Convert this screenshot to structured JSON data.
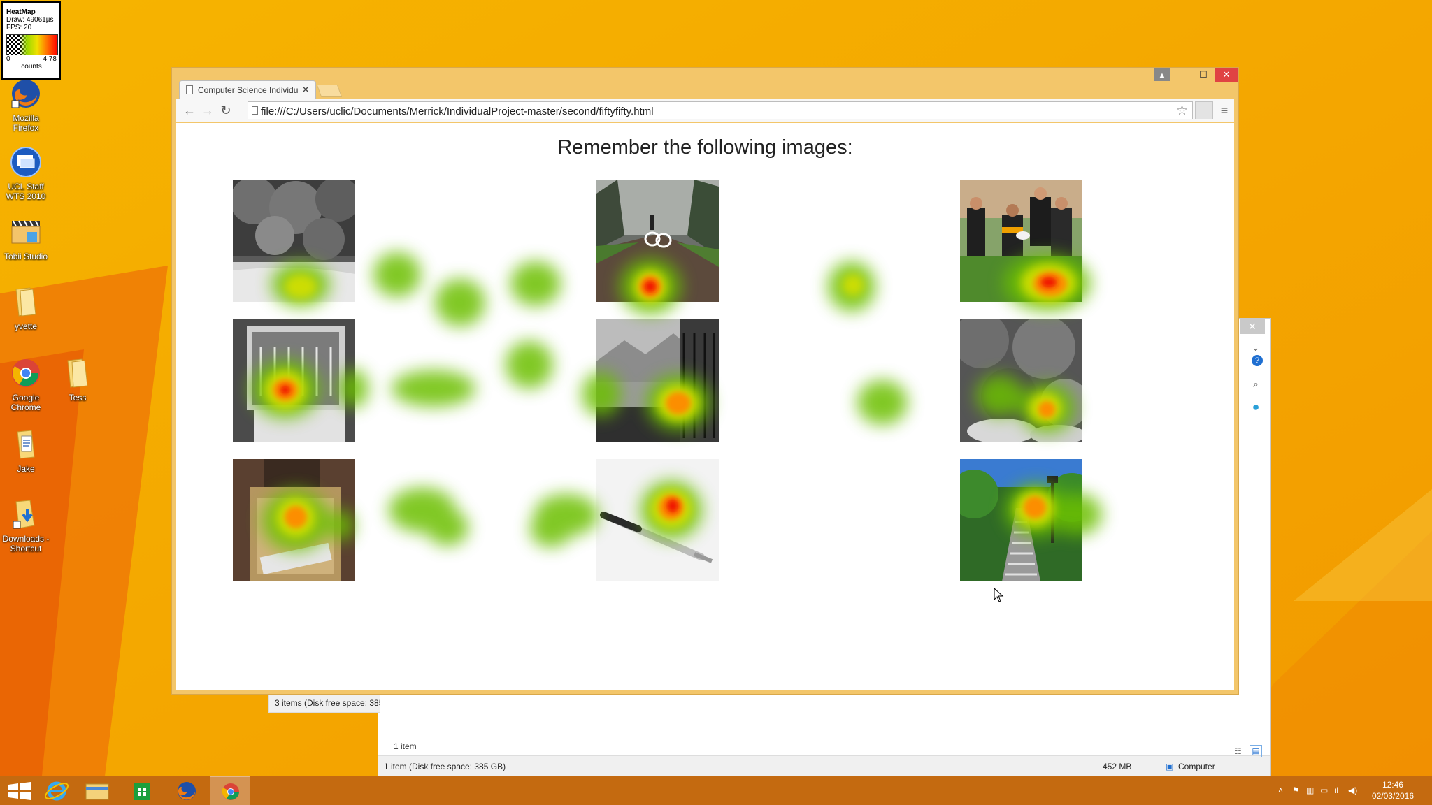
{
  "heatmap_widget": {
    "title": "HeatMap",
    "draw": "Draw: 49061µs",
    "fps": "FPS: 20",
    "min": "0",
    "max": "4.78",
    "unit": "counts"
  },
  "desktop": {
    "icons": [
      {
        "label": "Mozilla Firefox",
        "icon": "firefox-icon"
      },
      {
        "label": "UCL Staff WTS 2010",
        "icon": "remote-desktop-icon"
      },
      {
        "label": "Tobii Studio",
        "icon": "tobii-studio-icon"
      },
      {
        "label": "yvette",
        "icon": "folder-icon"
      },
      {
        "label": "Google Chrome",
        "icon": "chrome-icon"
      },
      {
        "label": "Tess",
        "icon": "folder-icon"
      },
      {
        "label": "Jake",
        "icon": "document-icon"
      },
      {
        "label": "Downloads - Shortcut",
        "icon": "folder-shortcut-icon"
      }
    ]
  },
  "browser": {
    "tab_title": "Computer Science Individu",
    "url": "file:///C:/Users/uclic/Documents/Merrick/IndividualProject-master/second/fiftyfifty.html",
    "page": {
      "heading": "Remember the following images:",
      "images": [
        {
          "subject": "black and white forest river"
        },
        {
          "subject": "headphones on a dirt path"
        },
        {
          "subject": "rugby players"
        },
        {
          "subject": "dishwasher with dishes"
        },
        {
          "subject": "black and white mountain lake balcony"
        },
        {
          "subject": "black and white foliage"
        },
        {
          "subject": "perfume bottle"
        },
        {
          "subject": "pen on white paper"
        },
        {
          "subject": "park stairs with lamps"
        }
      ]
    }
  },
  "explorer": {
    "item_count": "1 item",
    "status_left": "1 item (Disk free space: 385 GB)",
    "status_size": "452 MB",
    "status_location": "Computer",
    "back_status": "3 items (Disk free space: 385"
  },
  "taskbar": {
    "time": "12:46",
    "date": "02/03/2016",
    "apps": [
      "start-icon",
      "internet-explorer-icon",
      "file-explorer-icon",
      "store-icon",
      "firefox-icon",
      "chrome-icon"
    ]
  },
  "colors": {
    "wallpaper": "#f5a800",
    "taskbar": "#c46a10",
    "chrome_frame": "#f3c66a",
    "close_red": "#e04343"
  }
}
